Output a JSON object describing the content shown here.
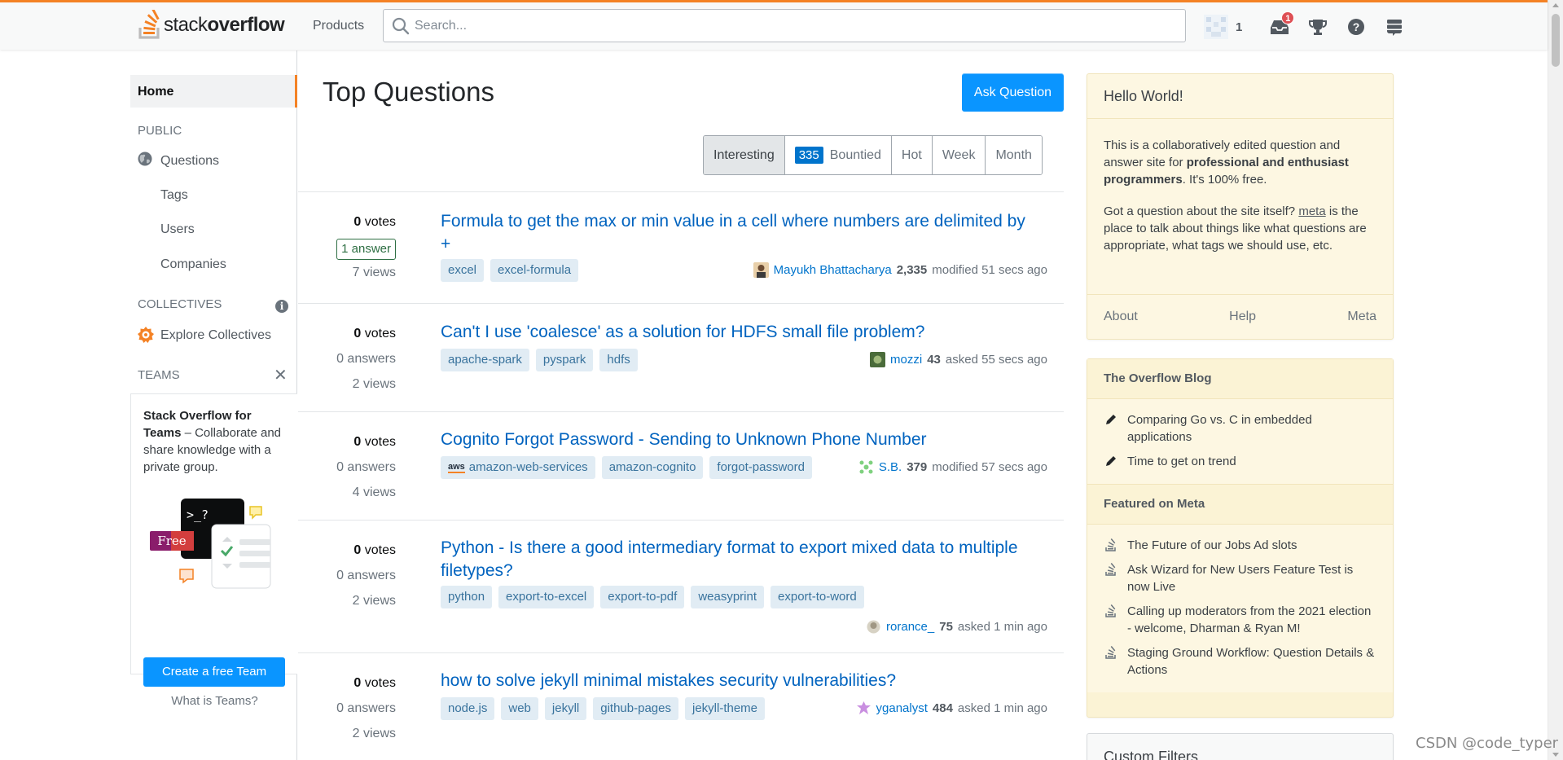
{
  "header": {
    "logo_prefix": "stack",
    "logo_bold": "overflow",
    "products_label": "Products",
    "search_placeholder": "Search...",
    "reputation": "1",
    "inbox_count": "1"
  },
  "left_nav": {
    "home": "Home",
    "public_label": "PUBLIC",
    "questions": "Questions",
    "tags": "Tags",
    "users": "Users",
    "companies": "Companies",
    "collectives_label": "COLLECTIVES",
    "explore_collectives": "Explore Collectives",
    "teams_label": "TEAMS",
    "teams_promo_bold": "Stack Overflow for Teams",
    "teams_promo_text": " – Collaborate and share knowledge with a private group.",
    "free_label": "Free",
    "terminal_prompt": ">_?",
    "create_team": "Create a free Team",
    "what_is_teams": "What is Teams?"
  },
  "main": {
    "title": "Top Questions",
    "ask_button": "Ask Question",
    "filters": {
      "interesting": "Interesting",
      "bountied_count": "335",
      "bountied": "Bountied",
      "hot": "Hot",
      "week": "Week",
      "month": "Month"
    },
    "questions": [
      {
        "votes": "0",
        "votes_label": "votes",
        "answers": "1 answer",
        "views": "7 views",
        "title": "Formula to get the max or min value in a cell where numbers are delimited by +",
        "tags": [
          "excel",
          "excel-formula"
        ],
        "user": "Mayukh Bhattacharya",
        "rep": "2,335",
        "action": "modified 51 secs ago"
      },
      {
        "votes": "0",
        "votes_label": "votes",
        "answers": "0 answers",
        "views": "2 views",
        "title": "Can't I use 'coalesce' as a solution for HDFS small file problem?",
        "tags": [
          "apache-spark",
          "pyspark",
          "hdfs"
        ],
        "user": "mozzi",
        "rep": "43",
        "action": "asked 55 secs ago"
      },
      {
        "votes": "0",
        "votes_label": "votes",
        "answers": "0 answers",
        "views": "4 views",
        "title": "Cognito Forgot Password - Sending to Unknown Phone Number",
        "tags": [
          "amazon-web-services",
          "amazon-cognito",
          "forgot-password"
        ],
        "aws_prefix": "aws",
        "user": "S.B.",
        "rep": "379",
        "action": "modified 57 secs ago"
      },
      {
        "votes": "0",
        "votes_label": "votes",
        "answers": "0 answers",
        "views": "2 views",
        "title": "Python - Is there a good intermediary format to export mixed data to multiple filetypes?",
        "tags": [
          "python",
          "export-to-excel",
          "export-to-pdf",
          "weasyprint",
          "export-to-word"
        ],
        "user": "rorance_",
        "rep": "75",
        "action": "asked 1 min ago"
      },
      {
        "votes": "0",
        "votes_label": "votes",
        "answers": "0 answers",
        "views": "2 views",
        "title": "how to solve jekyll minimal mistakes security vulnerabilities?",
        "tags": [
          "node.js",
          "web",
          "jekyll",
          "github-pages",
          "jekyll-theme"
        ],
        "user": "yganalyst",
        "rep": "484",
        "action": "asked 1 min ago"
      }
    ]
  },
  "sidebar": {
    "hello_title": "Hello World!",
    "hello_p1_start": "This is a collaboratively edited question and answer site for ",
    "hello_p1_bold": "professional and enthusiast programmers",
    "hello_p1_end": ". It's 100% free.",
    "hello_p2_start": "Got a question about the site itself? ",
    "hello_p2_link": "meta",
    "hello_p2_end": " is the place to talk about things like what questions are appropriate, what tags we should use, etc.",
    "footer_about": "About",
    "footer_help": "Help",
    "footer_meta": "Meta",
    "blog_header": "The Overflow Blog",
    "blog_items": [
      "Comparing Go vs. C in embedded applications",
      "Time to get on trend"
    ],
    "meta_header": "Featured on Meta",
    "meta_items": [
      "The Future of our Jobs Ad slots",
      "Ask Wizard for New Users Feature Test is now Live",
      "Calling up moderators from the 2021 election - welcome, Dharman & Ryan M!",
      "Staging Ground Workflow: Question Details & Actions"
    ],
    "custom_filters": "Custom Filters"
  },
  "watermark": "CSDN @code_typer",
  "colors": {
    "accent": "#f48225",
    "primary_button": "#0a95ff",
    "link": "#0063bf",
    "tag_bg": "#e1ecf4",
    "tag_text": "#39739d",
    "widget_bg": "#fdf7e2",
    "answered": "#2f6f44",
    "inbox_badge": "#de4f54"
  }
}
